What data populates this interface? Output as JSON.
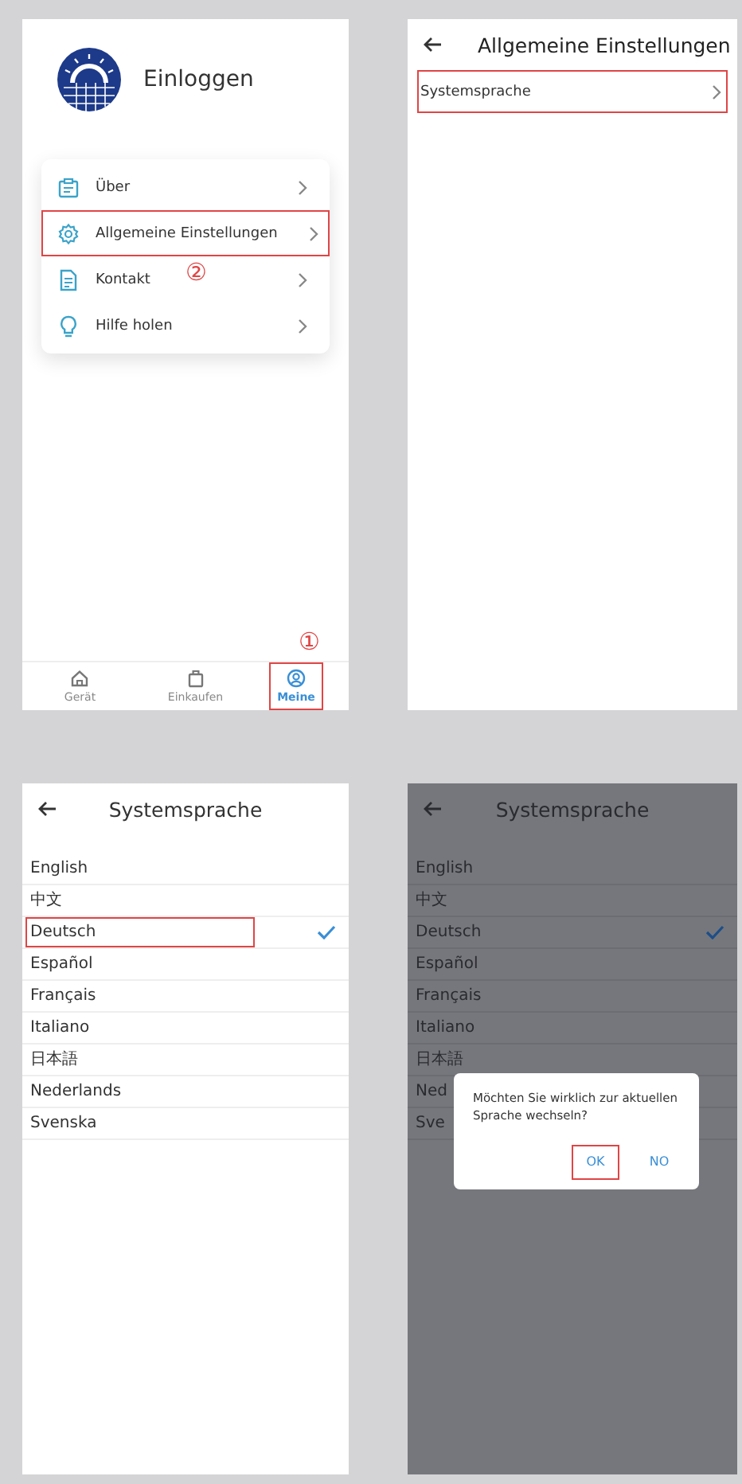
{
  "screens": [
    {
      "kind": "profile",
      "login_label": "Einloggen",
      "menu": [
        {
          "label": "Über",
          "highlighted": false
        },
        {
          "label": "Allgemeine Einstellungen",
          "highlighted": true
        },
        {
          "label": "Kontakt",
          "highlighted": false
        },
        {
          "label": "Hilfe holen",
          "highlighted": false
        }
      ],
      "menu_callout": "②",
      "nav_callout": "①",
      "nav": [
        {
          "label": "Gerät",
          "selected": false,
          "highlighted": false
        },
        {
          "label": "Einkaufen",
          "selected": false,
          "highlighted": false
        },
        {
          "label": "Meine",
          "selected": true,
          "highlighted": true
        }
      ]
    },
    {
      "kind": "settings",
      "title": "Allgemeine Einstellungen",
      "items": [
        {
          "label": "Systemsprache",
          "highlighted": true
        }
      ]
    },
    {
      "kind": "languages",
      "title": "Systemsprache",
      "dimmed": false,
      "languages": [
        {
          "label": "English",
          "selected": false,
          "highlighted": false
        },
        {
          "label": "中文",
          "selected": false,
          "highlighted": false
        },
        {
          "label": "Deutsch",
          "selected": true,
          "highlighted": true
        },
        {
          "label": "Español",
          "selected": false,
          "highlighted": false
        },
        {
          "label": "Français",
          "selected": false,
          "highlighted": false
        },
        {
          "label": "Italiano",
          "selected": false,
          "highlighted": false
        },
        {
          "label": "日本語",
          "selected": false,
          "highlighted": false
        },
        {
          "label": "Nederlands",
          "selected": false,
          "highlighted": false
        },
        {
          "label": "Svenska",
          "selected": false,
          "highlighted": false
        }
      ]
    },
    {
      "kind": "languages",
      "title": "Systemsprache",
      "dimmed": true,
      "languages": [
        {
          "label": "English",
          "selected": false,
          "highlighted": false
        },
        {
          "label": "中文",
          "selected": false,
          "highlighted": false
        },
        {
          "label": "Deutsch",
          "selected": true,
          "highlighted": false
        },
        {
          "label": "Español",
          "selected": false,
          "highlighted": false
        },
        {
          "label": "Français",
          "selected": false,
          "highlighted": false
        },
        {
          "label": "Italiano",
          "selected": false,
          "highlighted": false
        },
        {
          "label": "日本語",
          "selected": false,
          "highlighted": false
        },
        {
          "label": "Ned",
          "selected": false,
          "highlighted": false
        },
        {
          "label": "Sve",
          "selected": false,
          "highlighted": false
        }
      ],
      "dialog": {
        "message": "Möchten Sie wirklich zur aktuellen Sprache wechseln?",
        "buttons": [
          {
            "label": "OK",
            "highlighted": true
          },
          {
            "label": "NO",
            "highlighted": false
          }
        ]
      }
    }
  ]
}
